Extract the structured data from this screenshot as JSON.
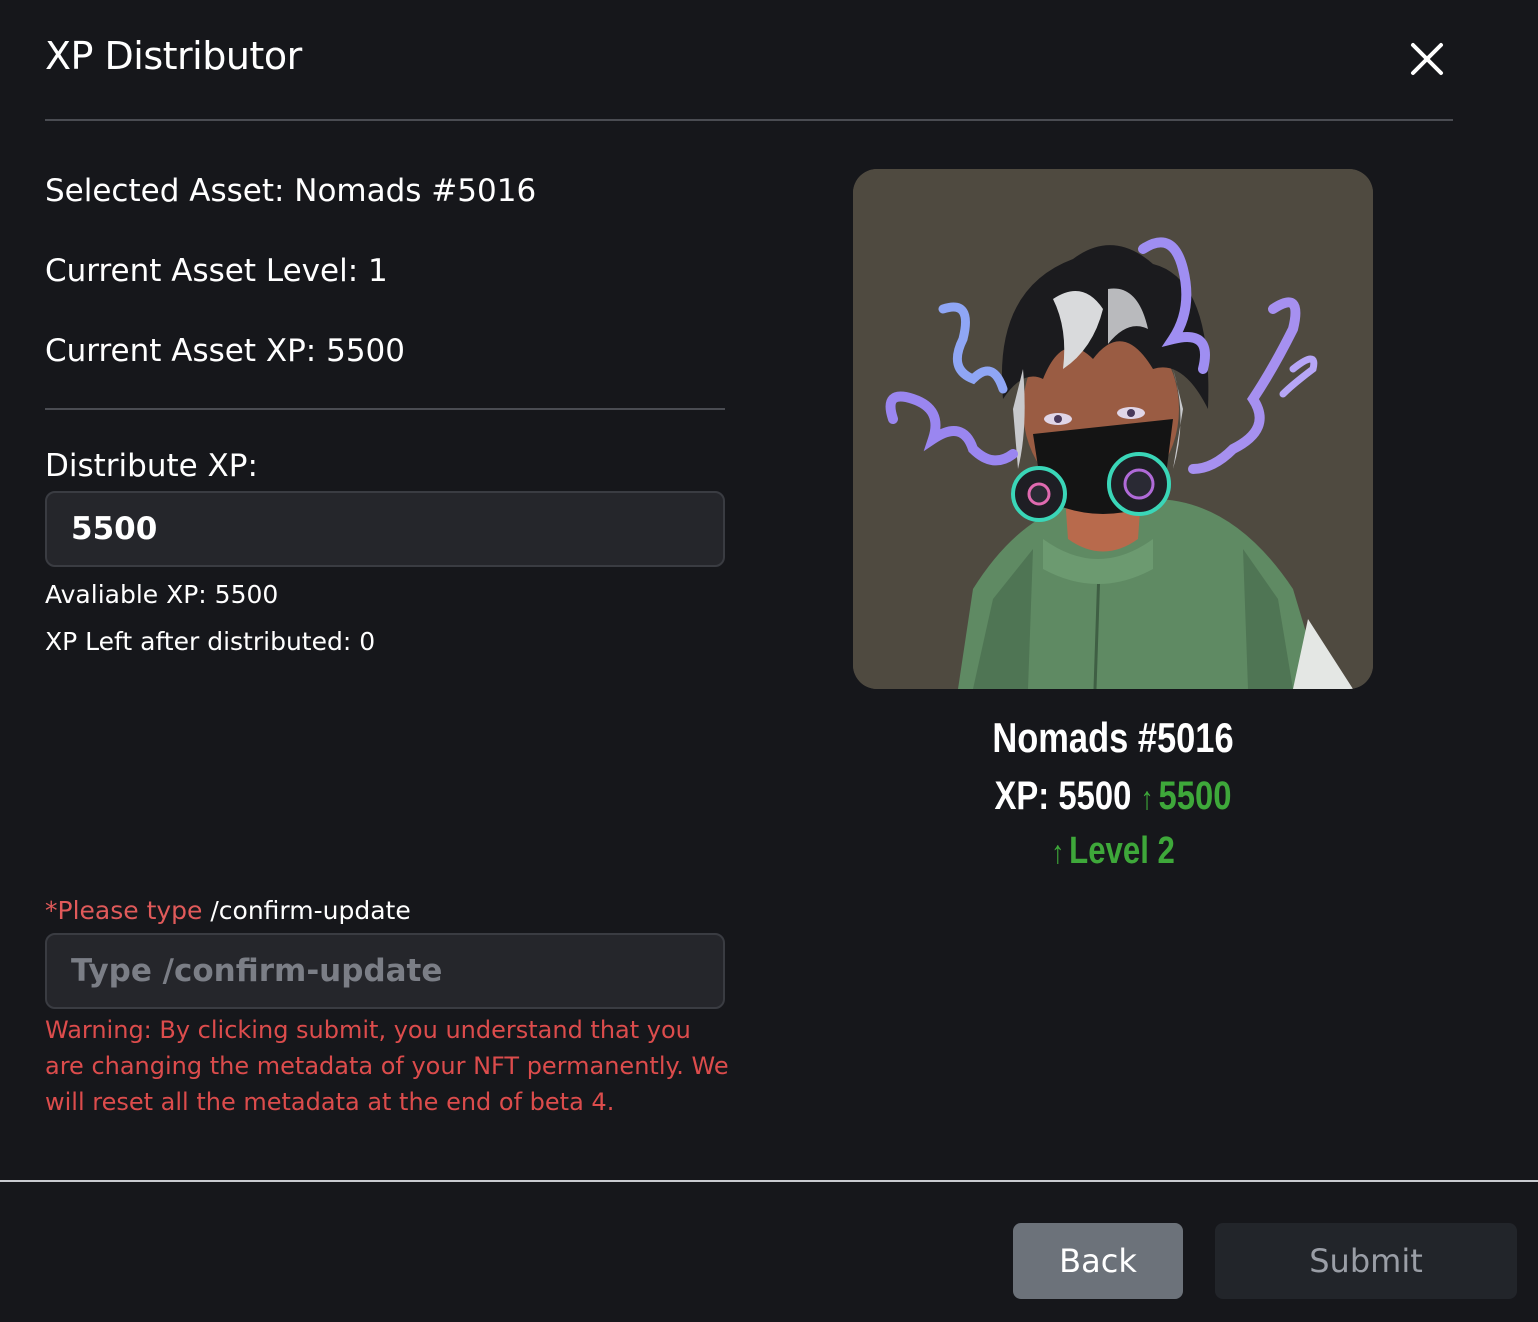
{
  "header": {
    "title": "XP Distributor"
  },
  "info": {
    "selected_asset": "Selected Asset: Nomads #5016",
    "current_level": "Current Asset Level: 1",
    "current_xp": "Current Asset XP: 5500"
  },
  "distribute": {
    "label": "Distribute XP:",
    "value": "5500",
    "available": "Avaliable XP: 5500",
    "left_after": "XP Left after distributed: 0"
  },
  "confirm": {
    "prefix": "*Please type",
    "command": "/confirm-update",
    "placeholder": "Type /confirm-update",
    "warning": "Warning: By clicking submit, you understand that you are changing the metadata of your NFT permanently. We will reset all the metadata at the end of beta 4."
  },
  "preview": {
    "name": "Nomads #5016",
    "xp_label": "XP: 5500",
    "xp_gain": "5500",
    "level_up": "Level 2",
    "arrow": "↑"
  },
  "footer": {
    "back_label": "Back",
    "submit_label": "Submit"
  },
  "colors": {
    "background": "#16171b",
    "warning": "#dc4c4c",
    "gain": "#3ea83a",
    "back_button": "#6c727a",
    "submit_button": "#22252a"
  }
}
